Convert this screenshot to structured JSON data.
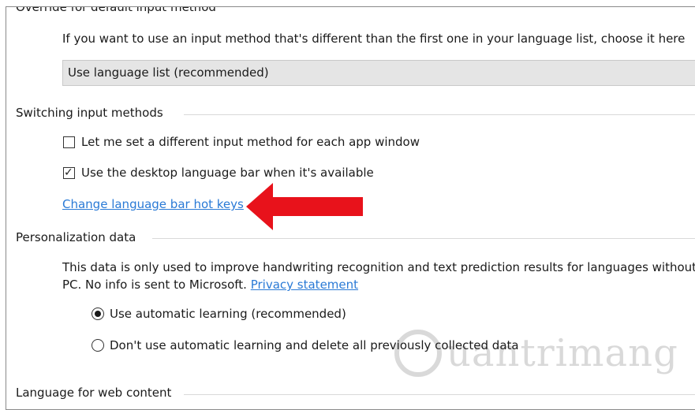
{
  "sections": {
    "override": {
      "title": "Override for default input method",
      "description": "If you want to use an input method that's different than the first one in your language list, choose it here",
      "dropdown_value": "Use language list (recommended)"
    },
    "switching": {
      "title": "Switching input methods",
      "checkbox_per_app_label": "Let me set a different input method for each app window",
      "checkbox_per_app_checked": false,
      "checkbox_language_bar_label": "Use the desktop language bar when it's available",
      "checkbox_language_bar_checked": true,
      "hotkeys_link": "Change language bar hot keys"
    },
    "personalization": {
      "title": "Personalization data",
      "description_line1": "This data is only used to improve handwriting recognition and text prediction results for languages without",
      "description_line2": "PC. No info is sent to Microsoft.",
      "privacy_link": "Privacy statement",
      "radio_auto_label": "Use automatic learning (recommended)",
      "radio_auto_selected": true,
      "radio_delete_label": "Don't use automatic learning and delete all previously collected data"
    },
    "web_content": {
      "title": "Language for web content"
    }
  },
  "annotation": {
    "arrow_color": "#e8121b"
  },
  "watermark": {
    "text": "uantrimang"
  },
  "colors": {
    "link": "#2a7ad6",
    "dropdown_bg": "#e5e5e5"
  }
}
